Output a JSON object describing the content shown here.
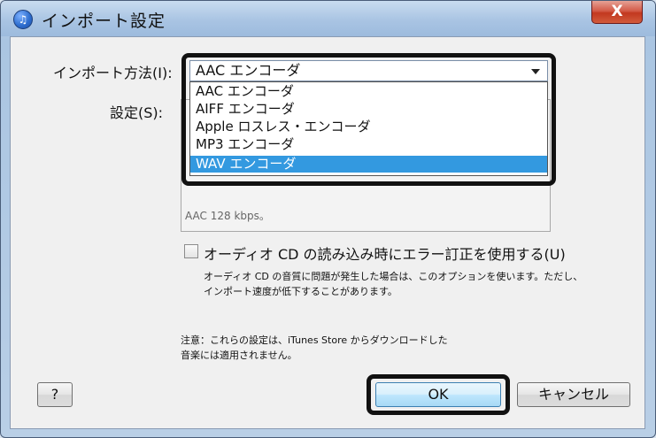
{
  "window": {
    "title": "インポート設定",
    "app_icon_glyph": "♫",
    "close_glyph": "X"
  },
  "form": {
    "import_method_label": "インポート方法(I):",
    "import_method_value": "AAC エンコーダ",
    "settings_label": "設定(S):",
    "settings_partial_text": "AAC 128 kbps。",
    "dropdown_options": [
      "AAC エンコーダ",
      "AIFF エンコーダ",
      "Apple ロスレス・エンコーダ",
      "MP3 エンコーダ",
      "WAV エンコーダ"
    ],
    "selected_option_index": 4,
    "error_correction_checked": false,
    "error_correction_label": "オーディオ CD の読み込み時にエラー訂正を使用する(U)",
    "error_correction_help_line1": "オーディオ CD の音質に問題が発生した場合は、このオプションを使います。ただし、",
    "error_correction_help_line2": "インポート速度が低下することがあります。",
    "note_line1": "注意：これらの設定は、iTunes Store からダウンロードした",
    "note_line2": "音楽には適用されません。"
  },
  "buttons": {
    "help": "?",
    "ok": "OK",
    "cancel": "キャンセル"
  },
  "colors": {
    "selection_blue": "#3399e0",
    "close_red": "#c2381f",
    "highlight_frame": "#111111"
  }
}
